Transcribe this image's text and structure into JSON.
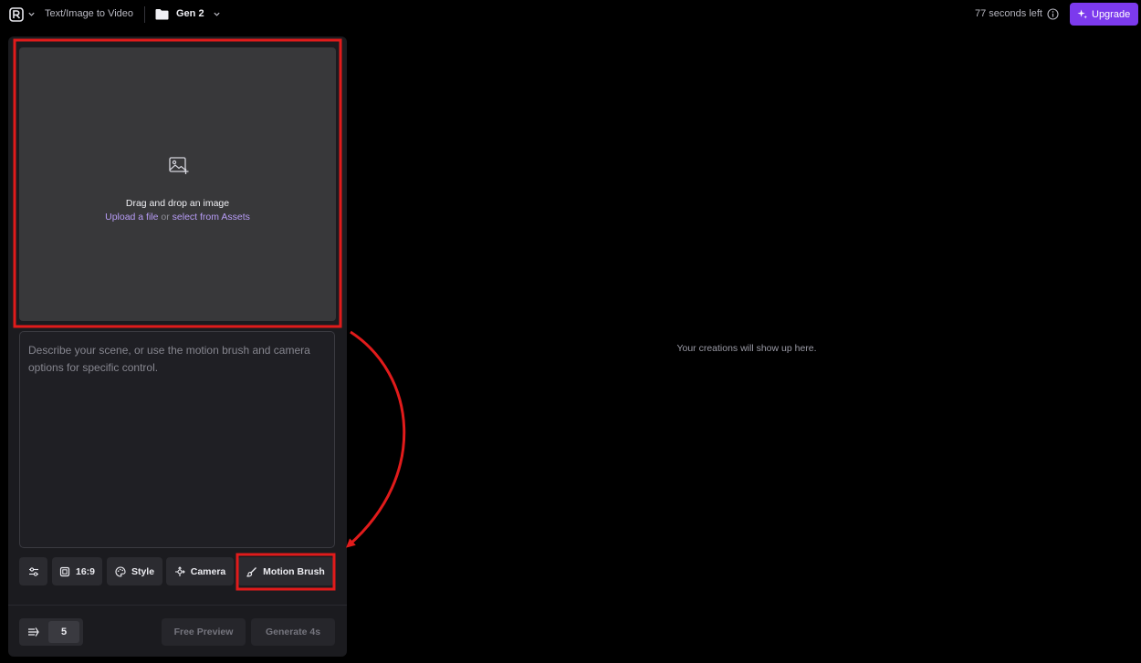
{
  "header": {
    "app_title": "Text/Image to Video",
    "folder_name": "Gen 2",
    "credits_left": "77 seconds left",
    "upgrade_label": "Upgrade"
  },
  "upload": {
    "title": "Drag and drop an image",
    "upload_link": "Upload a file",
    "or_text": "or",
    "assets_link": "select from Assets"
  },
  "prompt": {
    "placeholder": "Describe your scene, or use the motion brush and camera options for specific control."
  },
  "tools": {
    "aspect_ratio": "16:9",
    "style": "Style",
    "camera": "Camera",
    "motion_brush": "Motion Brush"
  },
  "footer": {
    "count": "5",
    "free_preview": "Free Preview",
    "generate": "Generate 4s"
  },
  "main": {
    "empty_message": "Your creations will show up here."
  },
  "colors": {
    "accent": "#7c3aed",
    "annotation": "#e11b1b",
    "link": "#b79cf6"
  }
}
